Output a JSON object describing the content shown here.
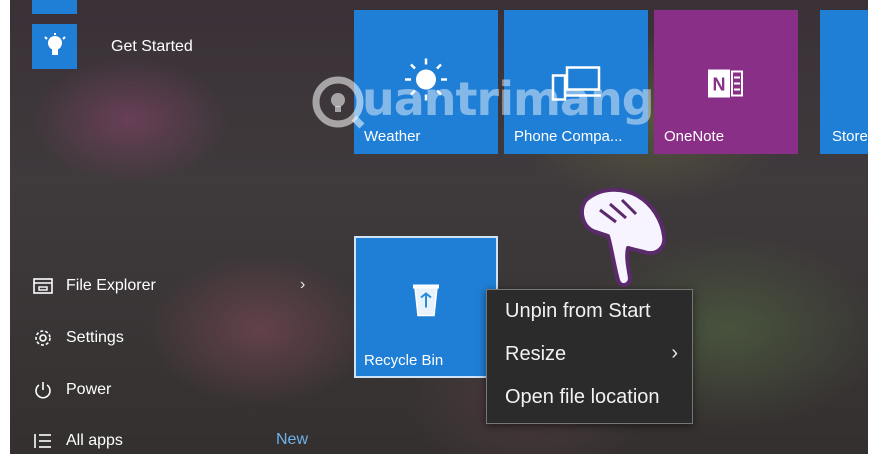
{
  "start_menu": {
    "get_started": "Get Started",
    "file_explorer": "File Explorer",
    "settings": "Settings",
    "power": "Power",
    "all_apps": "All apps",
    "new_badge": "New"
  },
  "tiles": {
    "weather": "Weather",
    "phone_companion": "Phone Compa...",
    "onenote": "OneNote",
    "store": "Store",
    "recycle_bin": "Recycle Bin"
  },
  "context_menu": {
    "unpin": "Unpin from Start",
    "resize": "Resize",
    "open_location": "Open file location"
  },
  "watermark": {
    "text": "uantrimang"
  },
  "colors": {
    "tile_blue": "#1f7fd6",
    "onenote_purple": "#8a2f88",
    "menu_bg": "#2b2b2b",
    "new_badge": "#6fb2ea"
  }
}
